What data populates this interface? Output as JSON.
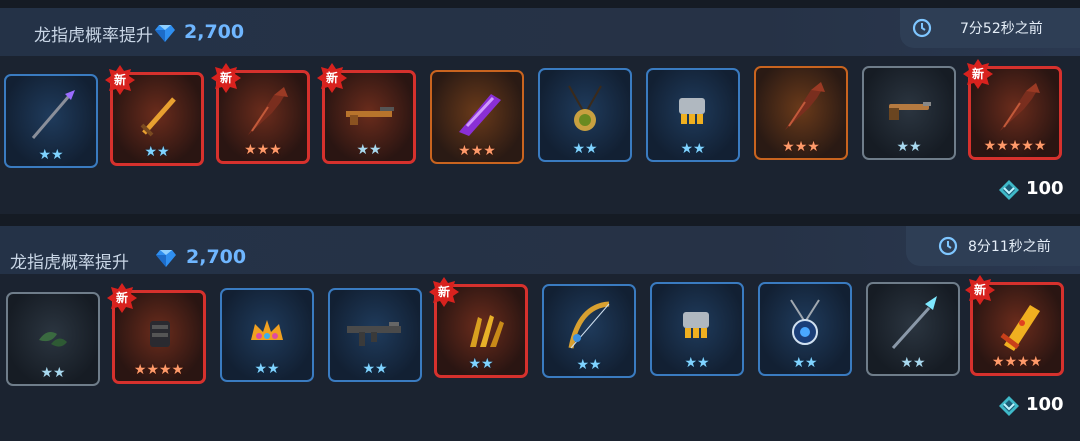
{
  "offers": [
    {
      "title": "龙指虎概率提升",
      "price": "2,700",
      "time_ago": "7分52秒之前",
      "cost": "100",
      "items": [
        {
          "name": "spear",
          "stars": "★★",
          "star_color": "blue",
          "rarity": "blue",
          "new": false
        },
        {
          "name": "sword",
          "stars": "★★",
          "star_color": "blue",
          "rarity": "red",
          "new": true
        },
        {
          "name": "dragon-claw",
          "stars": "★★★",
          "star_color": "orange",
          "rarity": "red",
          "new": true
        },
        {
          "name": "rifle",
          "stars": "★★",
          "star_color": "white",
          "rarity": "red",
          "new": true
        },
        {
          "name": "purple-blade",
          "stars": "★★★",
          "star_color": "orange",
          "rarity": "orange",
          "new": false
        },
        {
          "name": "amulet",
          "stars": "★★",
          "star_color": "blue",
          "rarity": "blue",
          "new": false
        },
        {
          "name": "gauntlet",
          "stars": "★★",
          "star_color": "blue",
          "rarity": "blue",
          "new": false
        },
        {
          "name": "dragon-claw",
          "stars": "★★★",
          "star_color": "orange",
          "rarity": "orange",
          "new": false
        },
        {
          "name": "pistol",
          "stars": "★★",
          "star_color": "white",
          "rarity": "white",
          "new": false
        },
        {
          "name": "dragon-claw",
          "stars": "★★★★★",
          "star_color": "orange",
          "rarity": "red",
          "new": true
        }
      ]
    },
    {
      "title": "龙指虎概率提升",
      "price": "2,700",
      "time_ago": "8分11秒之前",
      "cost": "100",
      "items": [
        {
          "name": "leaf-charm",
          "stars": "★★",
          "star_color": "white",
          "rarity": "white",
          "new": false
        },
        {
          "name": "dark-armor",
          "stars": "★★★★",
          "star_color": "orange",
          "rarity": "red",
          "new": true
        },
        {
          "name": "crown",
          "stars": "★★",
          "star_color": "blue",
          "rarity": "blue",
          "new": false
        },
        {
          "name": "assault-rifle",
          "stars": "★★",
          "star_color": "blue",
          "rarity": "blue",
          "new": false
        },
        {
          "name": "golden-claw",
          "stars": "★★",
          "star_color": "blue",
          "rarity": "red",
          "new": true
        },
        {
          "name": "golden-bow",
          "stars": "★★",
          "star_color": "blue",
          "rarity": "blue",
          "new": false
        },
        {
          "name": "gauntlet",
          "stars": "★★",
          "star_color": "blue",
          "rarity": "blue",
          "new": false
        },
        {
          "name": "sapphire-necklace",
          "stars": "★★",
          "star_color": "blue",
          "rarity": "blue",
          "new": false
        },
        {
          "name": "ice-spear",
          "stars": "★★",
          "star_color": "white",
          "rarity": "white",
          "new": false
        },
        {
          "name": "golden-greatsword",
          "stars": "★★★★",
          "star_color": "orange",
          "rarity": "red",
          "new": true
        }
      ]
    }
  ],
  "new_badge_label": "新",
  "colors": {
    "price": "#6fb6ff",
    "rare_border": "#3a7bc0",
    "legend_border": "#d6312d",
    "epic_border": "#c9641f"
  }
}
